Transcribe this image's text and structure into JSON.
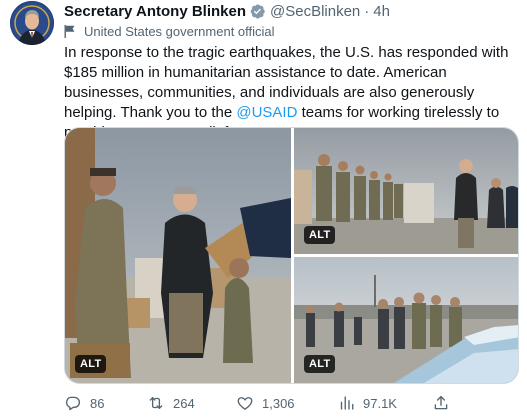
{
  "tweet": {
    "author_name": "Secretary Antony Blinken",
    "handle": "@SecBlinken",
    "separator": "·",
    "time": "4h",
    "label": "United States government official",
    "text_before": "In response to the tragic earthquakes, the U.S. has responded with $185 million in humanitarian assistance to date.  American businesses, communities, and individuals are also generously helping. Thank you to the ",
    "mention": "@USAID",
    "text_after": " teams for working tirelessly to provide emergency relief."
  },
  "media": {
    "alt_badge": "ALT",
    "photos": [
      {
        "position": "left",
        "alt_badge": "ALT"
      },
      {
        "position": "top-right",
        "alt_badge": "ALT"
      },
      {
        "position": "bottom-right",
        "alt_badge": "ALT"
      }
    ]
  },
  "actions": {
    "reply_count": "86",
    "retweet_count": "264",
    "like_count": "1,306",
    "views_count": "97.1K",
    "icons": [
      "reply-icon",
      "retweet-icon",
      "like-icon",
      "views-icon",
      "share-icon"
    ]
  },
  "colors": {
    "verified_gray": "#829aab",
    "link_blue": "#1d9bf0",
    "muted_text": "#536471",
    "primary_text": "#0f1419",
    "border": "#cfd9de"
  }
}
